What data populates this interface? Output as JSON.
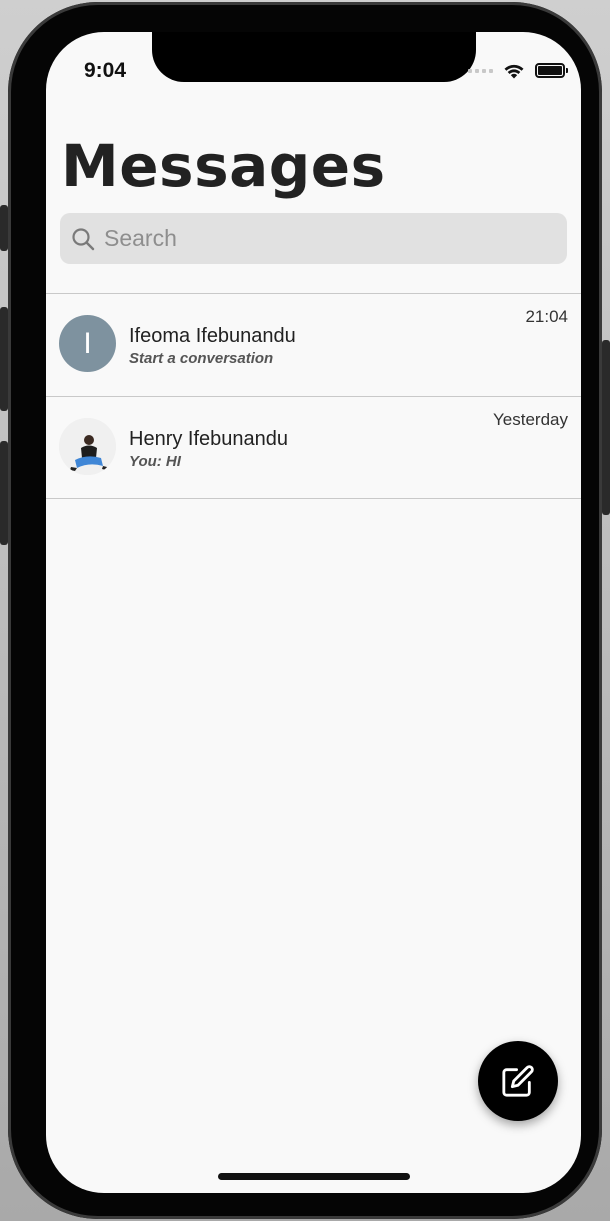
{
  "status_bar": {
    "time": "9:04"
  },
  "header": {
    "title": "Messages"
  },
  "search": {
    "placeholder": "Search"
  },
  "conversations": [
    {
      "avatar_initial": "I",
      "name": "Ifeoma Ifebunandu",
      "preview": "Start a conversation",
      "time": "21:04"
    },
    {
      "avatar_initial": "",
      "name": "Henry Ifebunandu",
      "preview": "You: HI",
      "time": "Yesterday"
    }
  ],
  "colors": {
    "avatar_bg": "#7e929f",
    "screen_bg": "#f9f9f9",
    "search_bg": "#e1e1e1",
    "fab_bg": "#000000"
  },
  "icons": {
    "search": "search-icon",
    "compose": "compose-icon",
    "wifi": "wifi-icon",
    "battery": "battery-icon",
    "signal": "signal-icon"
  }
}
